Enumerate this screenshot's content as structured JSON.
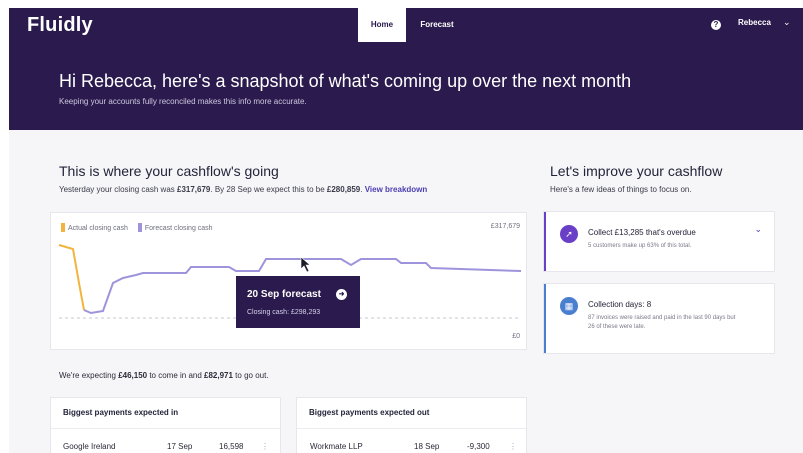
{
  "app": {
    "logo": "Fluidly"
  },
  "nav": {
    "tabs": [
      {
        "label": "Home",
        "active": true
      },
      {
        "label": "Forecast",
        "active": false
      }
    ],
    "help_icon": "help-circle-icon",
    "user_name": "Rebecca"
  },
  "hero": {
    "title": "Hi Rebecca, here's a snapshot of what's coming up over the next month",
    "subtitle": "Keeping your accounts fully reconciled makes this info more accurate."
  },
  "cashflow": {
    "title": "This is where your cashflow's going",
    "summary_prefix": "Yesterday your closing cash was ",
    "closing_cash": "£317,679",
    "summary_mid": ". By 28 Sep we expect this to be ",
    "expected_cash": "£280,859",
    "summary_suffix": ".",
    "view_breakdown": "View breakdown"
  },
  "chart_data": {
    "type": "line",
    "series": [
      {
        "name": "Actual closing cash",
        "color": "#f2b43c"
      },
      {
        "name": "Forecast closing cash",
        "color": "#9d94dc"
      }
    ],
    "y_top_label": "£317,679",
    "y_bottom_label": "£0",
    "tooltip": {
      "title": "20 Sep forecast",
      "subtitle": "Closing cash: £298,293"
    }
  },
  "expectation": {
    "prefix": "We're expecting ",
    "incoming": "£46,150",
    "mid": " to come in and ",
    "outgoing": "£82,971",
    "suffix": " to go out."
  },
  "payments_in": {
    "title": "Biggest payments expected in",
    "rows": [
      {
        "name": "Google Ireland",
        "date": "17 Sep",
        "amount": "16,598"
      }
    ]
  },
  "payments_out": {
    "title": "Biggest payments expected out",
    "rows": [
      {
        "name": "Workmate LLP",
        "date": "18 Sep",
        "amount": "-9,300"
      }
    ]
  },
  "improve": {
    "title": "Let's improve your cashflow",
    "subtitle": "Here's a few ideas of things to focus on.",
    "cards": [
      {
        "title": "Collect £13,285 that's overdue",
        "desc": "5 customers make up 63% of this total.",
        "icon": "rocket-icon",
        "accent": "#6a3fc8"
      },
      {
        "title": "Collection days: 8",
        "desc": "87 invoices were raised and paid in the last 90 days but 26 of these were late.",
        "icon": "calendar-icon",
        "accent": "#4a7fd0"
      }
    ]
  },
  "colors": {
    "brand": "#2a1a4d",
    "accent": "#4b3fb0",
    "forecast": "#9d94dc",
    "actual": "#f2b43c"
  }
}
